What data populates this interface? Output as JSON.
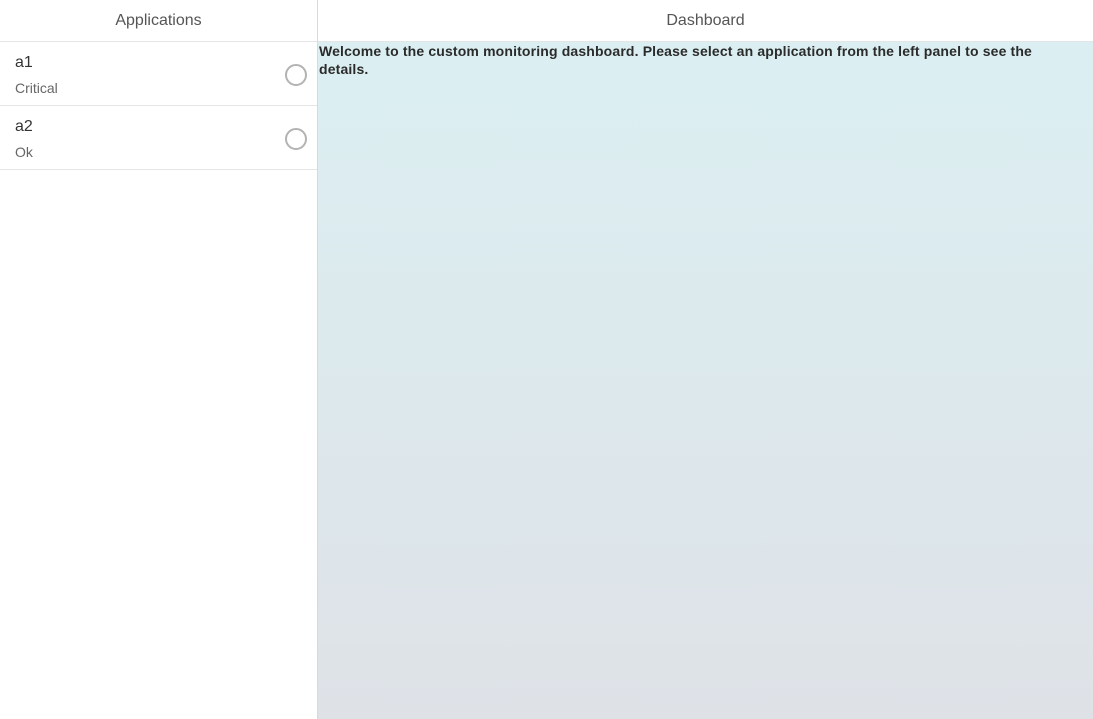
{
  "master": {
    "title": "Applications",
    "items": [
      {
        "name": "a1",
        "status": "Critical",
        "selected": false
      },
      {
        "name": "a2",
        "status": "Ok",
        "selected": false
      }
    ]
  },
  "detail": {
    "title": "Dashboard",
    "welcome_text": "Welcome to the custom monitoring dashboard. Please select an application from the left panel to see the details."
  },
  "colors": {
    "gradient_top": "#dbeff2",
    "gradient_bottom": "#dee2e7",
    "radio_border": "#b3b3b3"
  }
}
